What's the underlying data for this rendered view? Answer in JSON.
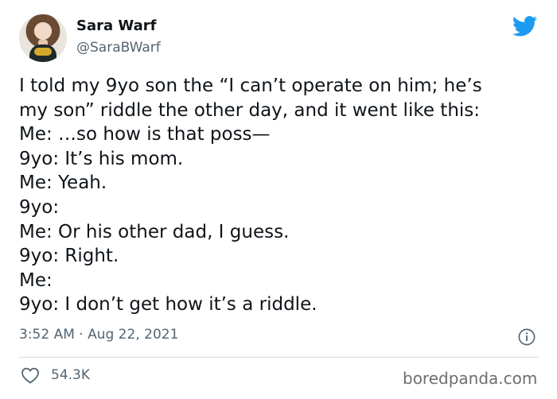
{
  "author": {
    "name": "Sara Warf",
    "handle": "@SaraBWarf",
    "avatar_icon": "profile-photo"
  },
  "brand_icon": "twitter-bird-icon",
  "brand_color": "#1d9bf0",
  "tweet": {
    "lines": [
      "I told my 9yo son the “I can’t operate on him; he’s",
      "my son” riddle the other day, and it went like this:",
      "Me: …so how is that poss—",
      "9yo: It’s his mom.",
      "Me: Yeah.",
      "9yo:",
      "Me: Or his other dad, I guess.",
      "9yo: Right.",
      "Me:",
      "9yo: I don’t get how it’s a riddle."
    ]
  },
  "meta": {
    "timestamp": "3:52 AM · Aug 22, 2021",
    "info_icon": "info-icon"
  },
  "engagement": {
    "like_icon": "heart-icon",
    "like_count": "54.3K"
  },
  "watermark": "boredpanda.com"
}
